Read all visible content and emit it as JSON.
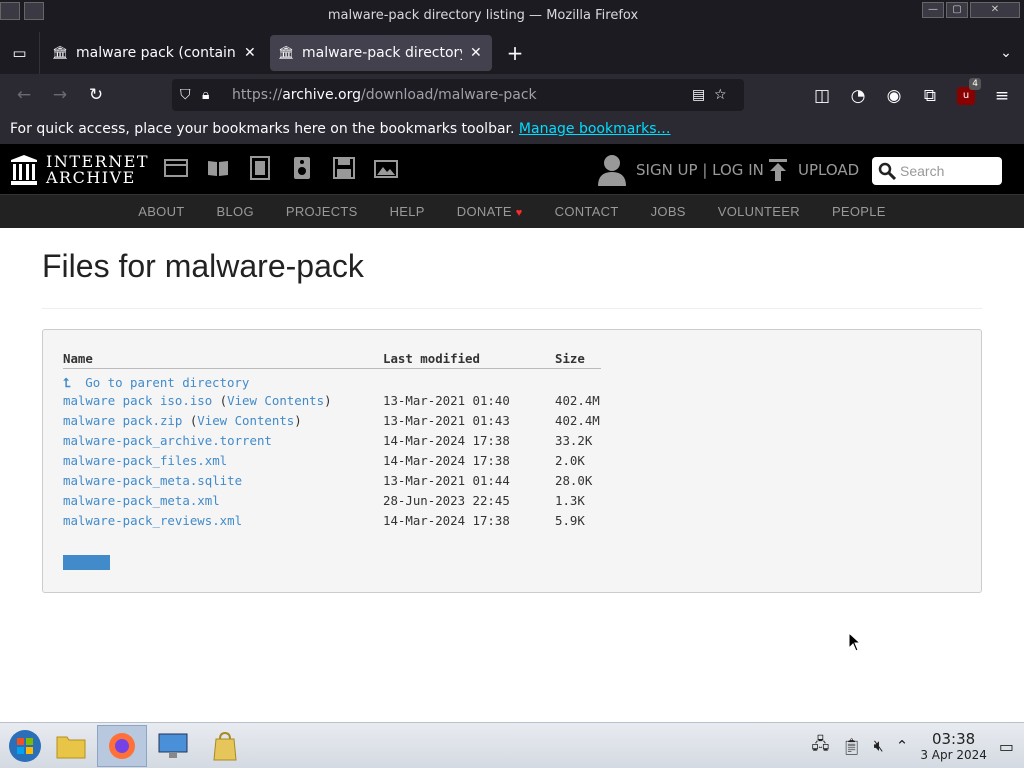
{
  "window": {
    "title": "malware-pack directory listing — Mozilla Firefox"
  },
  "tabs": [
    {
      "title": "malware pack (contains m",
      "active": false
    },
    {
      "title": "malware-pack directory li",
      "active": true
    }
  ],
  "urlbar": {
    "url_prefix": "https://",
    "url_host": "archive.org",
    "url_path": "/download/malware-pack"
  },
  "ublock_badge": "4",
  "bookmarks_bar": {
    "message": "For quick access, place your bookmarks here on the bookmarks toolbar.",
    "link": "Manage bookmarks…"
  },
  "ia_header": {
    "logo_line1": "INTERNET",
    "logo_line2": "ARCHIVE",
    "user_label": "SIGN UP | LOG IN",
    "upload_label": "UPLOAD",
    "search_placeholder": "Search"
  },
  "ia_nav": [
    "ABOUT",
    "BLOG",
    "PROJECTS",
    "HELP",
    "DONATE",
    "CONTACT",
    "JOBS",
    "VOLUNTEER",
    "PEOPLE"
  ],
  "page": {
    "title": "Files for malware-pack",
    "columns": {
      "name": "Name",
      "modified": "Last modified",
      "size": "Size"
    },
    "parent_link": "Go to parent directory",
    "view_contents": "View Contents",
    "files": [
      {
        "name": "malware pack iso.iso",
        "view": true,
        "modified": "13-Mar-2021 01:40",
        "size": "402.4M"
      },
      {
        "name": "malware pack.zip",
        "view": true,
        "modified": "13-Mar-2021 01:43",
        "size": "402.4M"
      },
      {
        "name": "malware-pack_archive.torrent",
        "view": false,
        "modified": "14-Mar-2024 17:38",
        "size": "33.2K"
      },
      {
        "name": "malware-pack_files.xml",
        "view": false,
        "modified": "14-Mar-2024 17:38",
        "size": "2.0K"
      },
      {
        "name": "malware-pack_meta.sqlite",
        "view": false,
        "modified": "13-Mar-2021 01:44",
        "size": "28.0K"
      },
      {
        "name": "malware-pack_meta.xml",
        "view": false,
        "modified": "28-Jun-2023 22:45",
        "size": "1.3K"
      },
      {
        "name": "malware-pack_reviews.xml",
        "view": false,
        "modified": "14-Mar-2024 17:38",
        "size": "5.9K"
      }
    ]
  },
  "taskbar": {
    "time": "03:38",
    "date": "3 Apr 2024"
  },
  "colors": {
    "link": "#428bca",
    "heart": "#ff2a2a",
    "firefox_dark": "#1c1b22"
  }
}
